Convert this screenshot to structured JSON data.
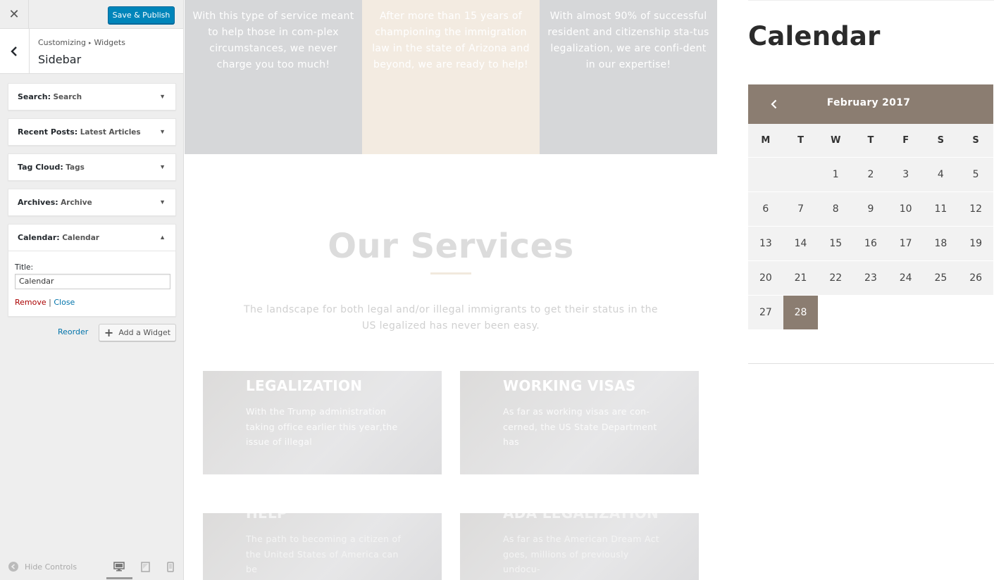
{
  "customizer": {
    "close_symbol": "✕",
    "save_label": "Save & Publish",
    "breadcrumb": {
      "part1": "Customizing",
      "separator": "▸",
      "part2": "Widgets"
    },
    "section_title": "Sidebar",
    "widgets": [
      {
        "type": "Search:",
        "title": "Search",
        "arrow": "▼"
      },
      {
        "type": "Recent Posts:",
        "title": "Latest Articles",
        "arrow": "▼"
      },
      {
        "type": "Tag Cloud:",
        "title": "Tags",
        "arrow": "▼"
      },
      {
        "type": "Archives:",
        "title": "Archive",
        "arrow": "▼"
      },
      {
        "type": "Calendar:",
        "title": "Calendar",
        "arrow": "▲"
      }
    ],
    "calendar_form": {
      "title_label": "Title:",
      "title_value": "Calendar",
      "remove_label": "Remove",
      "divider": "|",
      "close_label": "Close"
    },
    "reorder_label": "Reorder",
    "add_widget_label": "Add a Widget",
    "add_widget_symbol": "+",
    "hide_controls_label": "Hide Controls"
  },
  "preview": {
    "columns": [
      "With this type of service meant to help those in com-plex circumstances, we never charge you too much!",
      "After more than 15 years of championing the immigration law in the state of Arizona and beyond, we are ready to help!",
      "With almost 90% of successful resident and citizenship sta-tus legalization, we are confi-dent in our expertise!"
    ],
    "services_title": "Our Services",
    "services_desc": "The landscape for both legal and/or illegal immigrants to get their status in the US legalized has never been easy.",
    "cards": [
      {
        "title": "LEGALIZATION",
        "text": "With the Trump administration taking office earlier this year,the issue of illegal"
      },
      {
        "title": "WORKING VISAS",
        "text": "As far as working visas are con-cerned, the US State Department has"
      },
      {
        "title": "HELP",
        "text": "The path to becoming a citizen of the United States of America can be"
      },
      {
        "title": "ADA LEGALIZATION",
        "text": "As far as the American Dream Act goes, millions of previously undocu-"
      }
    ],
    "calendar": {
      "heading": "Calendar",
      "month": "February 2017",
      "weekdays": [
        "M",
        "T",
        "W",
        "T",
        "F",
        "S",
        "S"
      ],
      "weeks": [
        [
          "",
          "",
          "1",
          "2",
          "3",
          "4",
          "5"
        ],
        [
          "6",
          "7",
          "8",
          "9",
          "10",
          "11",
          "12"
        ],
        [
          "13",
          "14",
          "15",
          "16",
          "17",
          "18",
          "19"
        ],
        [
          "20",
          "21",
          "22",
          "23",
          "24",
          "25",
          "26"
        ],
        [
          "27",
          "28",
          "",
          "",
          "",
          "",
          ""
        ]
      ],
      "today": "28",
      "accent_color": "#8b7d71"
    }
  }
}
